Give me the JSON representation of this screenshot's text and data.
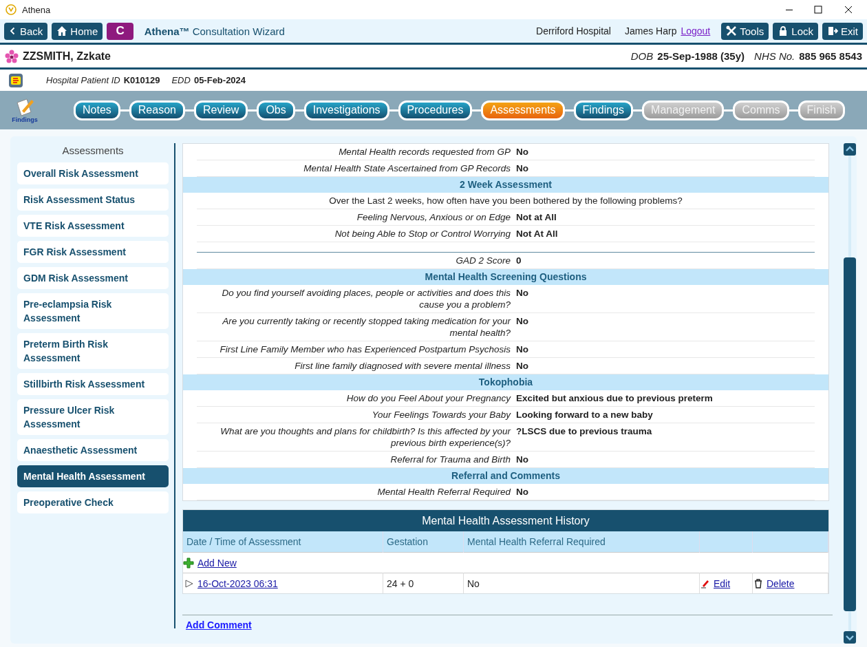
{
  "window": {
    "title": "Athena"
  },
  "toolbar": {
    "back": "Back",
    "home": "Home",
    "c_button": "C",
    "app_title": "**Athena™** Consultation Wizard",
    "hospital": "Derriford Hospital",
    "user": "James Harp",
    "logout": "Logout",
    "tools": "Tools",
    "lock": "Lock",
    "exit": "Exit"
  },
  "patient": {
    "name": "ZZSMITH, Zzkate",
    "dob_label": "DOB",
    "dob": "25-Sep-1988 (35y)",
    "nhs_label": "NHS No.",
    "nhs": "885 965 8543",
    "id_label": "Hospital Patient ID",
    "id": "K010129",
    "edd_label": "EDD",
    "edd": "05-Feb-2024"
  },
  "wizard": {
    "icon_label": "Findings",
    "steps": [
      {
        "label": "Notes",
        "selected": false,
        "disabled": false
      },
      {
        "label": "Reason",
        "selected": false,
        "disabled": false
      },
      {
        "label": "Review",
        "selected": false,
        "disabled": false
      },
      {
        "label": "Obs",
        "selected": false,
        "disabled": false
      },
      {
        "label": "Investigations",
        "selected": false,
        "disabled": false
      },
      {
        "label": "Procedures",
        "selected": false,
        "disabled": false
      },
      {
        "label": "Assessments",
        "selected": true,
        "disabled": false
      },
      {
        "label": "Findings",
        "selected": false,
        "disabled": false
      },
      {
        "label": "Management",
        "selected": false,
        "disabled": true
      },
      {
        "label": "Comms",
        "selected": false,
        "disabled": true
      },
      {
        "label": "Finish",
        "selected": false,
        "disabled": true
      }
    ]
  },
  "sidebar": {
    "title": "Assessments",
    "items": [
      {
        "label": "Overall Risk Assessment",
        "selected": false
      },
      {
        "label": "Risk Assessment Status",
        "selected": false
      },
      {
        "label": "VTE Risk Assessment",
        "selected": false
      },
      {
        "label": "FGR Risk Assessment",
        "selected": false
      },
      {
        "label": "GDM Risk Assessment",
        "selected": false
      },
      {
        "label": "Pre-eclampsia Risk Assessment",
        "selected": false
      },
      {
        "label": "Preterm Birth Risk Assessment",
        "selected": false
      },
      {
        "label": "Stillbirth Risk Assessment",
        "selected": false
      },
      {
        "label": "Pressure Ulcer Risk Assessment",
        "selected": false
      },
      {
        "label": "Anaesthetic Assessment",
        "selected": false
      },
      {
        "label": "Mental Health Assessment",
        "selected": true
      },
      {
        "label": "Preoperative Check",
        "selected": false
      }
    ]
  },
  "form": {
    "rows": [
      {
        "kind": "field",
        "label": "Mental Health records requested from GP",
        "value": "No"
      },
      {
        "kind": "field",
        "label": "Mental Health State Ascertained from GP Records",
        "value": "No"
      },
      {
        "kind": "section",
        "label": "2 Week Assessment"
      },
      {
        "kind": "question",
        "label": "Over the Last 2 weeks, how often have you been bothered by the following problems?"
      },
      {
        "kind": "field",
        "label": "Feeling Nervous, Anxious or on Edge",
        "value": "Not at All"
      },
      {
        "kind": "field",
        "label": "Not being Able to Stop or Control Worrying",
        "value": "Not At All"
      },
      {
        "kind": "divider"
      },
      {
        "kind": "field",
        "label": "GAD 2 Score",
        "value": "0"
      },
      {
        "kind": "section",
        "label": "Mental Health Screening Questions"
      },
      {
        "kind": "field",
        "label": "Do you find yourself avoiding places, people or activities and does this cause you a problem?",
        "value": "No"
      },
      {
        "kind": "field",
        "label": "Are you currently taking or recently stopped taking medication for your mental health?",
        "value": "No"
      },
      {
        "kind": "field",
        "label": "First Line Family Member who has Experienced Postpartum Psychosis",
        "value": "No"
      },
      {
        "kind": "field",
        "label": "First line family diagnosed with severe mental illness",
        "value": "No"
      },
      {
        "kind": "section",
        "label": "Tokophobia"
      },
      {
        "kind": "field",
        "label": "How do you Feel About your Pregnancy",
        "value": "Excited but anxious due to previous preterm"
      },
      {
        "kind": "field",
        "label": "Your Feelings Towards your Baby",
        "value": "Looking forward to a new baby"
      },
      {
        "kind": "field",
        "label": "What are you thoughts and plans for childbirth? Is this affected by your previous birth experience(s)?",
        "value": "?LSCS due to previous trauma"
      },
      {
        "kind": "field",
        "label": "Referral for Trauma and Birth",
        "value": "No"
      },
      {
        "kind": "section",
        "label": "Referral and Comments"
      },
      {
        "kind": "field",
        "label": "Mental Health Referral Required",
        "value": "No"
      }
    ]
  },
  "history": {
    "title": "Mental Health Assessment History",
    "columns": [
      "Date / Time of Assessment",
      "Gestation",
      "Mental Health Referral Required"
    ],
    "add_new": "Add New",
    "rows": [
      {
        "date": "16-Oct-2023 06:31",
        "gestation": "24 + 0",
        "referral": "No",
        "edit": "Edit",
        "delete": "Delete"
      }
    ]
  },
  "add_comment": "Add Comment"
}
